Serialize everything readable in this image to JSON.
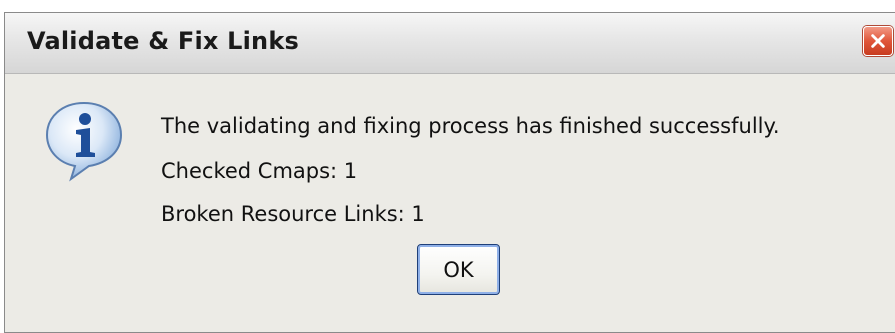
{
  "window": {
    "title": "Validate & Fix Links",
    "close_icon": "close-icon"
  },
  "dialog": {
    "icon": "info-icon",
    "message": "The validating and fixing process has finished successfully.",
    "checked_cmaps": "Checked Cmaps:  1",
    "broken_links": "Broken Resource Links:  1",
    "ok_label": "OK"
  },
  "colors": {
    "dialog_background": "#ecebe6",
    "close_button": "#e0563a",
    "ok_focus_ring": "#8fb0e8"
  }
}
